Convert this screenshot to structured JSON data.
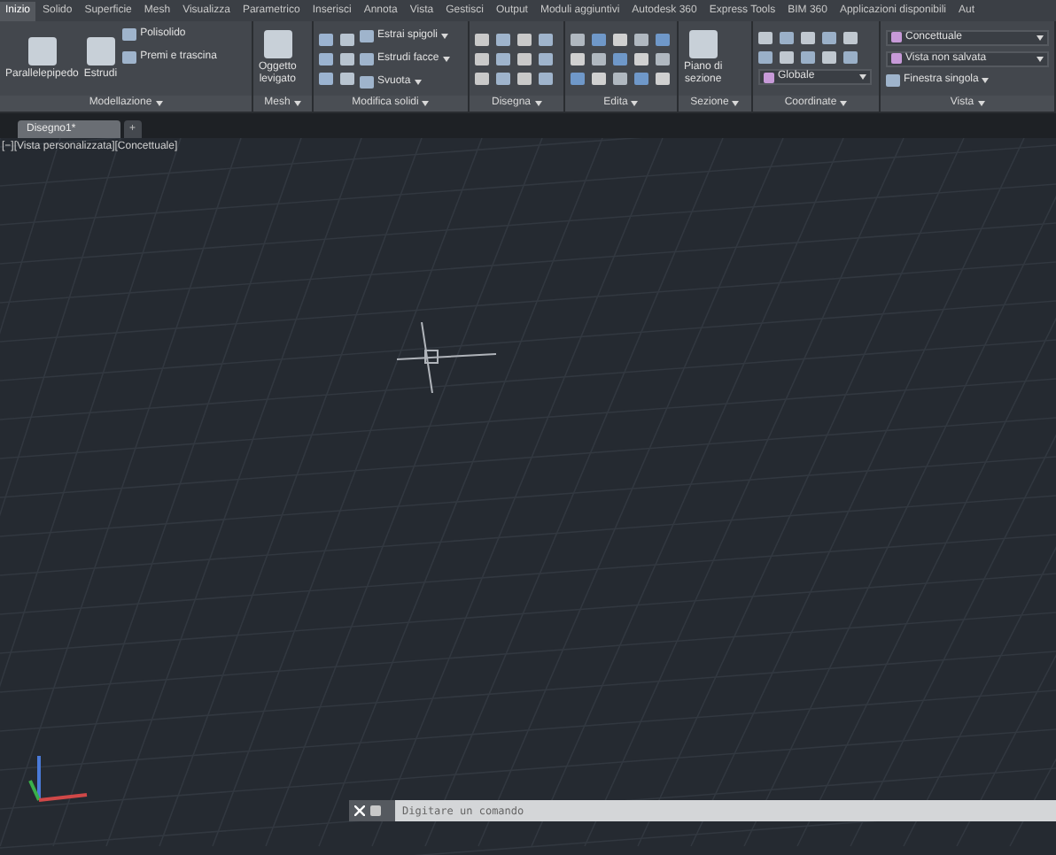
{
  "menu_tabs": [
    {
      "label": "Inizio",
      "selected": true
    },
    {
      "label": "Solido",
      "selected": false
    },
    {
      "label": "Superficie",
      "selected": false
    },
    {
      "label": "Mesh",
      "selected": false
    },
    {
      "label": "Visualizza",
      "selected": false
    },
    {
      "label": "Parametrico",
      "selected": false
    },
    {
      "label": "Inserisci",
      "selected": false
    },
    {
      "label": "Annota",
      "selected": false
    },
    {
      "label": "Vista",
      "selected": false
    },
    {
      "label": "Gestisci",
      "selected": false
    },
    {
      "label": "Output",
      "selected": false
    },
    {
      "label": "Moduli aggiuntivi",
      "selected": false
    },
    {
      "label": "Autodesk 360",
      "selected": false
    },
    {
      "label": "Express Tools",
      "selected": false
    },
    {
      "label": "BIM 360",
      "selected": false
    },
    {
      "label": "Applicazioni disponibili",
      "selected": false
    },
    {
      "label": "Aut",
      "selected": false
    }
  ],
  "ribbon": {
    "modellazione": {
      "label": "Modellazione",
      "big_tools": [
        "Parallelepipedo",
        "Estrudi"
      ],
      "small_tools": [
        "Polisolido",
        "Premi e trascina"
      ]
    },
    "mesh": {
      "label": "Mesh",
      "big_tool": "Oggetto levigato"
    },
    "modifica_solidi": {
      "label": "Modifica solidi",
      "small_tools": [
        "Estrai spigoli",
        "Estrudi facce",
        "Svuota"
      ]
    },
    "disegna": {
      "label": "Disegna"
    },
    "edita": {
      "label": "Edita"
    },
    "sezione": {
      "label": "Sezione",
      "big_tool": "Piano di sezione"
    },
    "coordinate": {
      "label": "Coordinate",
      "dropdown": "Globale"
    },
    "vista": {
      "label": "Vista",
      "dropdowns": [
        "Concettuale",
        "Vista non salvata"
      ],
      "small_tool": "Finestra singola"
    }
  },
  "document_tabs": [
    {
      "label": "Disegno1*",
      "selected": true
    },
    {
      "label": "+",
      "selected": false
    }
  ],
  "viewport_label": "[−][Vista personalizzata][Concettuale]",
  "command_line": {
    "placeholder": "Digitare un comando"
  }
}
